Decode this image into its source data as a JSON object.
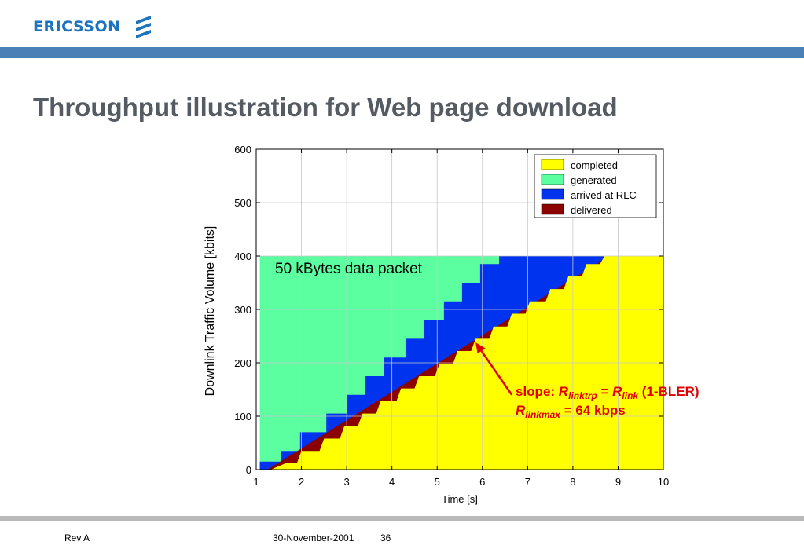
{
  "header": {
    "logo_text": "ERICSSON",
    "brand_color": "#1e73be",
    "bar_color": "#4a80b6"
  },
  "slide": {
    "title": "Throughput illustration for Web page download"
  },
  "footer": {
    "rev": "Rev A",
    "date": "30-November-2001",
    "page": "36"
  },
  "annotations": {
    "packet_label": "50 kBytes data packet",
    "slope_prefix": "slope: ",
    "slope_r": "R",
    "slope_sub1": "linktrp",
    "slope_eq": " = ",
    "slope_sub2": "link",
    "slope_suffix": " (1-BLER)",
    "rate_r": "R",
    "rate_sub": "linkmax",
    "rate_suffix": " = 64 kbps",
    "annotation_color": "#e00000"
  },
  "chart_data": {
    "type": "area",
    "xlabel": "Time [s]",
    "ylabel": "Downlink Traffic Volume [kbits]",
    "xlim": [
      1,
      10
    ],
    "ylim": [
      0,
      600
    ],
    "xticks": [
      1,
      2,
      3,
      4,
      5,
      6,
      7,
      8,
      9,
      10
    ],
    "yticks": [
      0,
      100,
      200,
      300,
      400,
      500,
      600
    ],
    "grid": true,
    "legend_position": "top-right",
    "series": [
      {
        "name": "generated",
        "color": "#5cffa0",
        "points": [
          [
            1.08,
            0
          ],
          [
            1.08,
            400
          ],
          [
            10,
            400
          ]
        ]
      },
      {
        "name": "arrived at RLC",
        "color": "#0033ee",
        "steps": [
          [
            1.08,
            15
          ],
          [
            1.55,
            35
          ],
          [
            1.97,
            70
          ],
          [
            2.55,
            105
          ],
          [
            3.0,
            140
          ],
          [
            3.4,
            175
          ],
          [
            3.82,
            210
          ],
          [
            4.3,
            245
          ],
          [
            4.7,
            280
          ],
          [
            5.15,
            315
          ],
          [
            5.55,
            350
          ],
          [
            5.95,
            385
          ],
          [
            6.37,
            400
          ],
          [
            10,
            400
          ]
        ]
      },
      {
        "name": "delivered",
        "color": "#8b0000",
        "points": [
          [
            1.25,
            0
          ],
          [
            8.8,
            400
          ],
          [
            10,
            400
          ]
        ]
      },
      {
        "name": "completed",
        "color": "#ffff00",
        "steps": [
          [
            1.0,
            0
          ],
          [
            1.32,
            0
          ],
          [
            1.65,
            12
          ],
          [
            1.9,
            12
          ],
          [
            2.0,
            35
          ],
          [
            2.4,
            35
          ],
          [
            2.5,
            58
          ],
          [
            2.85,
            58
          ],
          [
            2.95,
            82
          ],
          [
            3.25,
            82
          ],
          [
            3.35,
            105
          ],
          [
            3.65,
            105
          ],
          [
            3.75,
            128
          ],
          [
            4.1,
            128
          ],
          [
            4.2,
            152
          ],
          [
            4.5,
            152
          ],
          [
            4.6,
            175
          ],
          [
            4.95,
            175
          ],
          [
            5.05,
            198
          ],
          [
            5.35,
            198
          ],
          [
            5.45,
            222
          ],
          [
            5.75,
            222
          ],
          [
            5.85,
            245
          ],
          [
            6.15,
            245
          ],
          [
            6.25,
            268
          ],
          [
            6.55,
            268
          ],
          [
            6.65,
            292
          ],
          [
            6.95,
            292
          ],
          [
            7.05,
            315
          ],
          [
            7.4,
            315
          ],
          [
            7.5,
            338
          ],
          [
            7.8,
            338
          ],
          [
            7.9,
            362
          ],
          [
            8.2,
            362
          ],
          [
            8.3,
            385
          ],
          [
            8.6,
            385
          ],
          [
            8.7,
            400
          ],
          [
            10,
            400
          ]
        ]
      }
    ],
    "legend": [
      {
        "label": "completed",
        "color": "#ffff00"
      },
      {
        "label": "generated",
        "color": "#5cffa0"
      },
      {
        "label": "arrived at RLC",
        "color": "#0033ee"
      },
      {
        "label": " delivered",
        "color": "#8b0000"
      }
    ],
    "arrow": {
      "from": [
        6.65,
        140
      ],
      "to": [
        5.85,
        238
      ]
    }
  }
}
